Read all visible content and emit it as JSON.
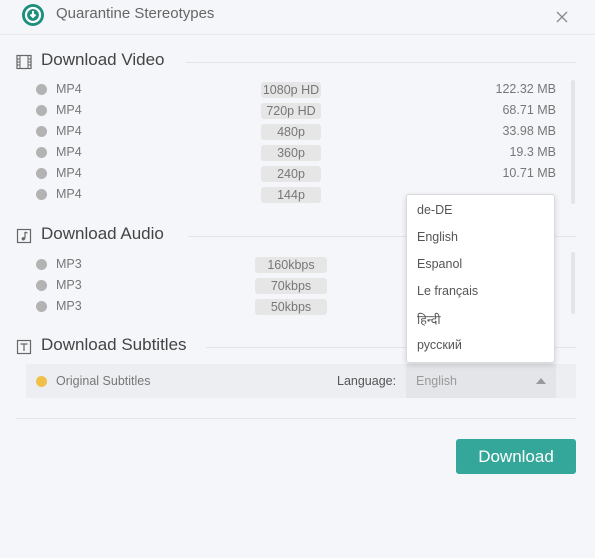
{
  "window": {
    "title": "Quarantine Stereotypes"
  },
  "video": {
    "heading": "Download Video",
    "items": [
      {
        "format": "MP4",
        "quality": "1080p HD",
        "size": "122.32 MB"
      },
      {
        "format": "MP4",
        "quality": "720p HD",
        "size": "68.71 MB"
      },
      {
        "format": "MP4",
        "quality": "480p",
        "size": "33.98 MB"
      },
      {
        "format": "MP4",
        "quality": "360p",
        "size": "19.3 MB"
      },
      {
        "format": "MP4",
        "quality": "240p",
        "size": "10.71 MB"
      },
      {
        "format": "MP4",
        "quality": "144p",
        "size": ""
      }
    ]
  },
  "audio": {
    "heading": "Download Audio",
    "items": [
      {
        "format": "MP3",
        "quality": "160kbps"
      },
      {
        "format": "MP3",
        "quality": "70kbps"
      },
      {
        "format": "MP3",
        "quality": "50kbps"
      }
    ]
  },
  "subtitles": {
    "heading": "Download Subtitles",
    "option_label": "Original Subtitles",
    "language_label": "Language:",
    "language_value": "English",
    "language_options": [
      "de-DE",
      "English",
      "Espanol",
      "Le français",
      "हिन्दी",
      "русский"
    ]
  },
  "download_label": "Download",
  "colors": {
    "accent": "#35a79a",
    "logo": "#1e8f7c",
    "selected_radio": "#f0c048",
    "radio": "#b3b3b3"
  }
}
